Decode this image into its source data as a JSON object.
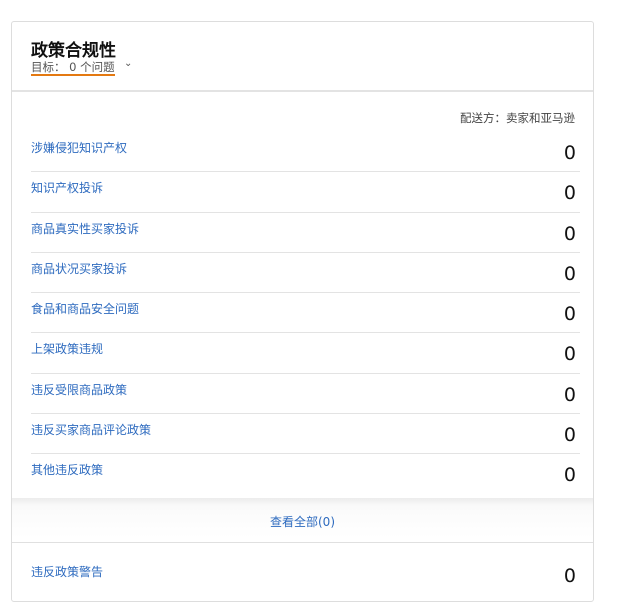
{
  "header": {
    "title": "政策合规性",
    "goal": "目标： 0 个问题"
  },
  "ship_by": "配送方：卖家和亚马逊",
  "rows": [
    {
      "label": "涉嫌侵犯知识产权",
      "value": "0"
    },
    {
      "label": "知识产权投诉",
      "value": "0"
    },
    {
      "label": "商品真实性买家投诉",
      "value": "0"
    },
    {
      "label": "商品状况买家投诉",
      "value": "0"
    },
    {
      "label": "食品和商品安全问题",
      "value": "0"
    },
    {
      "label": "上架政策违规",
      "value": "0"
    },
    {
      "label": "违反受限商品政策",
      "value": "0"
    },
    {
      "label": "违反买家商品评论政策",
      "value": "0"
    },
    {
      "label": "其他违反政策",
      "value": "0"
    }
  ],
  "view_all": "查看全部(0)",
  "warnings": {
    "label": "违反政策警告",
    "value": "0"
  }
}
